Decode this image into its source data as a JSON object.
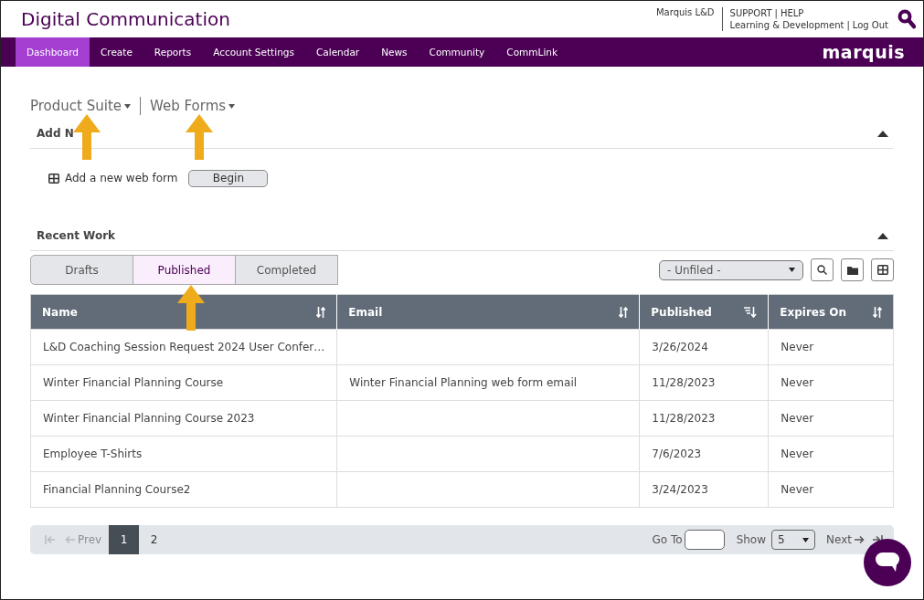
{
  "header": {
    "title": "Digital Communication",
    "user": "Marquis L&D",
    "separator": "|",
    "links_top": [
      "SUPPORT",
      "HELP"
    ],
    "links_bottom": [
      "Learning & Development",
      "Log Out"
    ]
  },
  "nav": {
    "items": [
      {
        "label": "Dashboard",
        "selected": true
      },
      {
        "label": "Create",
        "selected": false
      },
      {
        "label": "Reports",
        "selected": false
      },
      {
        "label": "Account Settings",
        "selected": false
      },
      {
        "label": "Calendar",
        "selected": false
      },
      {
        "label": "News",
        "selected": false
      },
      {
        "label": "Community",
        "selected": false
      },
      {
        "label": "CommLink",
        "selected": false
      }
    ],
    "logo": "marquis"
  },
  "breadcrumbs": [
    {
      "label": "Product Suite",
      "arrow": true
    },
    {
      "label": "Web Forms",
      "arrow": true
    }
  ],
  "add_new": {
    "title": "Add N",
    "expanded": true,
    "label": "Add a new web form",
    "button": "Begin"
  },
  "recent_work": {
    "title": "Recent Work",
    "expanded": true,
    "tabs": [
      {
        "label": "Drafts",
        "selected": false,
        "arrow": false
      },
      {
        "label": "Published",
        "selected": true,
        "arrow": true
      },
      {
        "label": "Completed",
        "selected": false,
        "arrow": false
      }
    ],
    "folder_select": "- Unfiled -",
    "table": {
      "columns": [
        {
          "label": "Name",
          "sorted": false
        },
        {
          "label": "Email",
          "sorted": false
        },
        {
          "label": "Published",
          "sorted": true
        },
        {
          "label": "Expires On",
          "sorted": false
        }
      ],
      "rows": [
        [
          "L&D Coaching Session Request 2024 User Confer…",
          "",
          "3/26/2024",
          "Never"
        ],
        [
          "Winter Financial Planning Course",
          "Winter Financial Planning web form email",
          "11/28/2023",
          "Never"
        ],
        [
          "Winter Financial Planning Course 2023",
          "",
          "11/28/2023",
          "Never"
        ],
        [
          "Employee T-Shirts",
          "",
          "7/6/2023",
          "Never"
        ],
        [
          "Financial Planning Course2",
          "",
          "3/24/2023",
          "Never"
        ]
      ]
    },
    "pagination": {
      "prev": "Prev",
      "pages": [
        {
          "label": "1",
          "selected": true
        },
        {
          "label": "2",
          "selected": false
        }
      ],
      "goto_label": "Go To",
      "show_label": "Show",
      "show_value": "5",
      "next": "Next"
    }
  }
}
